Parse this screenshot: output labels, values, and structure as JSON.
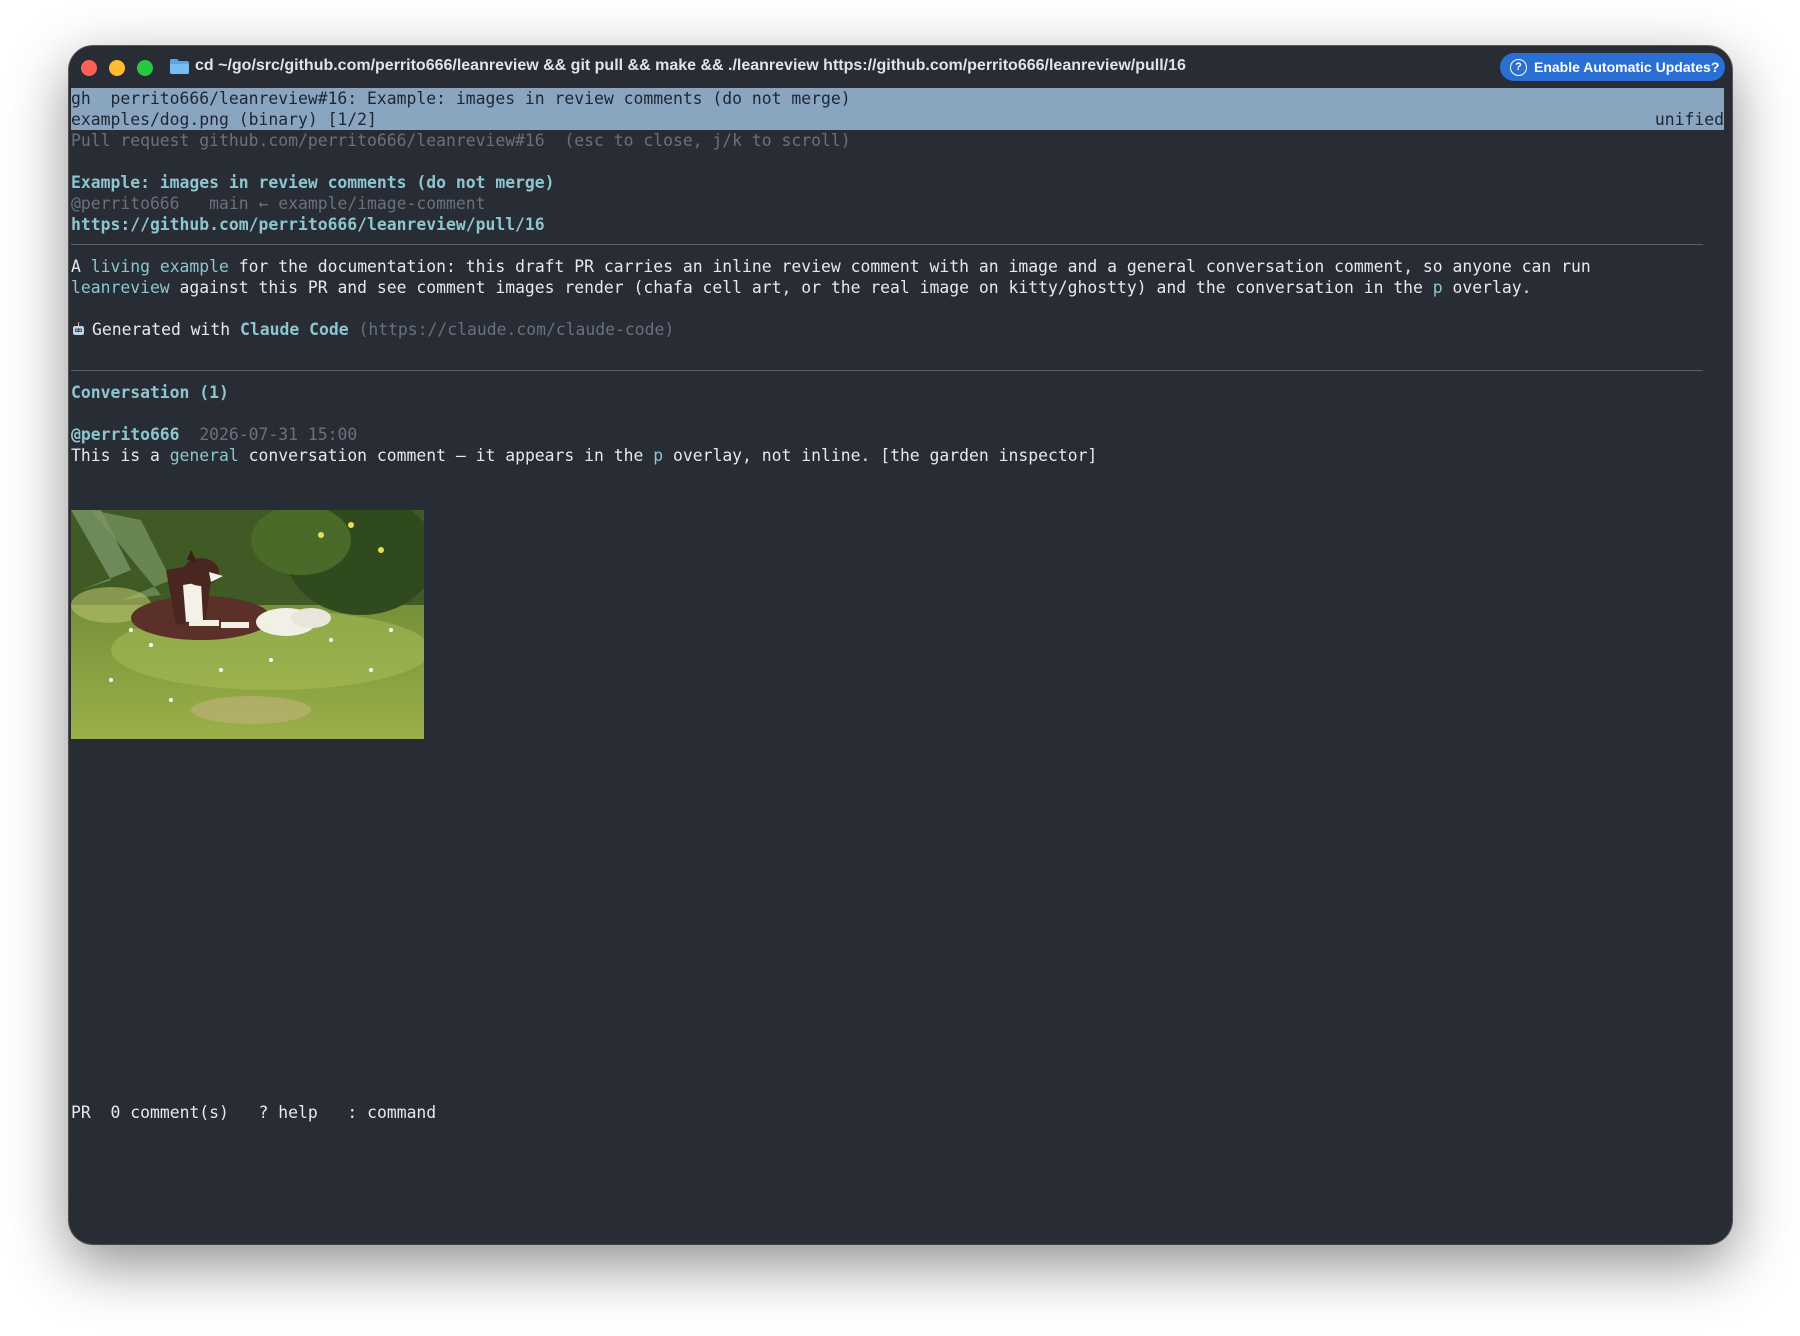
{
  "window": {
    "title": "cd ~/go/src/github.com/perrito666/leanreview && git pull && make && ./leanreview https://github.com/perrito666/leanreview/pull/16",
    "update_button": "Enable Automatic Updates?",
    "help_glyph": "?"
  },
  "header": {
    "line1": "gh  perrito666/leanreview#16: Example: images in review comments (do not merge)",
    "file": "examples/dog.png (binary) [1/2]",
    "mode": "unified"
  },
  "overlay": {
    "subtitle": "Pull request github.com/perrito666/leanreview#16  (esc to close, j/k to scroll)",
    "pr_title": "Example: images in review comments (do not merge)",
    "author": "@perrito666",
    "branches": "main ← example/image-comment",
    "url": "https://github.com/perrito666/leanreview/pull/16",
    "body1": {
      "p1": "A ",
      "link1": "living example",
      "p2": " for the documentation: this draft PR carries an inline review comment with an image and a general conversation comment, so anyone can run"
    },
    "body2": {
      "link": "leanreview",
      "p1": " against this PR and see comment images render (chafa cell art, or the real image on kitty/ghostty) and the conversation in the ",
      "key": "p",
      "p2": " overlay."
    },
    "generated": {
      "prefix": "Generated with ",
      "link": "Claude Code",
      "url": " (https://claude.com/claude-code)"
    },
    "conversation_heading": "Conversation (1)",
    "comment": {
      "author": "@perrito666",
      "timestamp": "2026-07-31 15:00",
      "t1": "This is a ",
      "link": "general",
      "t2": " conversation comment — it appears in the ",
      "key": "p",
      "t3": " overlay, not inline. [the garden inspector]"
    }
  },
  "statusbar": {
    "mode": "PR",
    "comments": "0 comment(s)",
    "help": "? help",
    "command": ": command"
  },
  "colors": {
    "background": "#282c35",
    "header_highlight": "#8aa5c0",
    "accent": "#8dc6cf",
    "dim": "#6b717c",
    "update_button": "#2a6fd4"
  }
}
